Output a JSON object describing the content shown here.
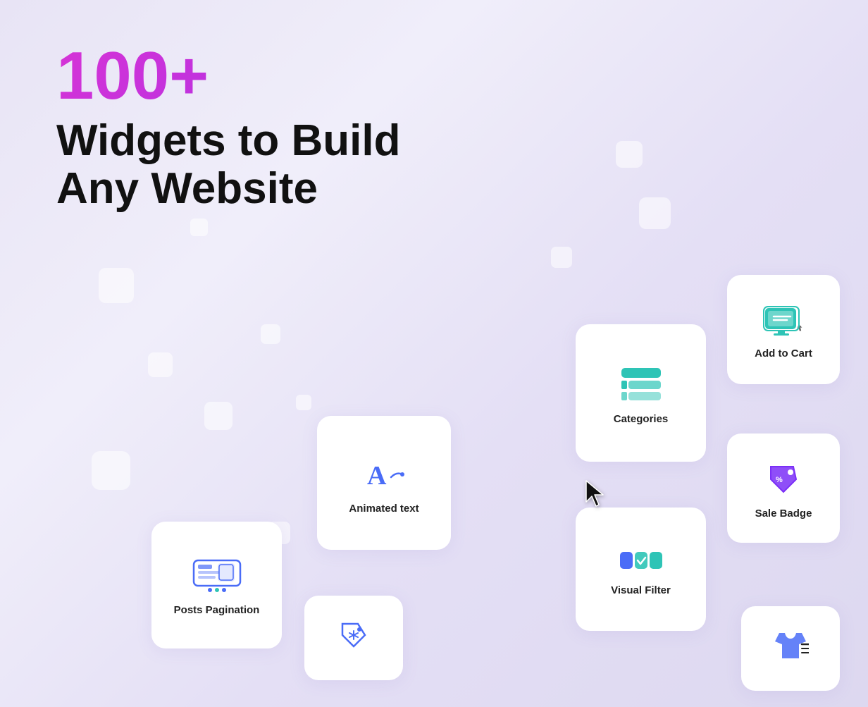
{
  "hero": {
    "count": "100+",
    "subtitle_line1": "Widgets to Build",
    "subtitle_line2": "Any Website"
  },
  "cards": [
    {
      "id": "add-to-cart",
      "label": "Add to Cart",
      "icon": "add-to-cart-icon"
    },
    {
      "id": "categories",
      "label": "Categories",
      "icon": "categories-icon"
    },
    {
      "id": "animated-text",
      "label": "Animated text",
      "icon": "animated-text-icon"
    },
    {
      "id": "posts-pagination",
      "label": "Posts Pagination",
      "icon": "posts-pagination-icon"
    },
    {
      "id": "sale-badge",
      "label": "Sale Badge",
      "icon": "sale-badge-icon"
    },
    {
      "id": "visual-filter",
      "label": "Visual Filter",
      "icon": "visual-filter-icon"
    }
  ],
  "colors": {
    "gradient_start": "#d633d6",
    "gradient_end": "#7b2ff7",
    "teal": "#2ec4b6",
    "blue": "#4a6cf7",
    "background": "#e8e4f5"
  }
}
